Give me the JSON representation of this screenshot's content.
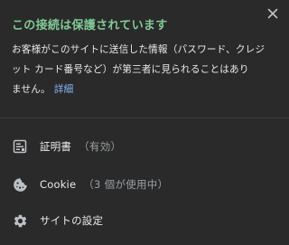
{
  "dialog": {
    "title": "この接続は保護されています",
    "description_line1": "お客様がこのサイトに送信した情報（パスワード、クレジ",
    "description_line2": "ット カード番号など）が第三者に見られることはあり",
    "description_line3": "ません。",
    "details_link": "詳細",
    "close_icon": "close-icon"
  },
  "items": [
    {
      "icon": "certificate-icon",
      "label": "証明書",
      "sub": "（有効）"
    },
    {
      "icon": "cookie-icon",
      "label": "Cookie",
      "sub": "（3 個が使用中）"
    },
    {
      "icon": "gear-icon",
      "label": "サイトの設定",
      "sub": ""
    }
  ],
  "colors": {
    "background": "#2a2a2a",
    "title_green": "#81c995",
    "link_blue": "#8ab4f8",
    "text": "#e8eaed",
    "secondary_text": "#9aa0a6"
  }
}
